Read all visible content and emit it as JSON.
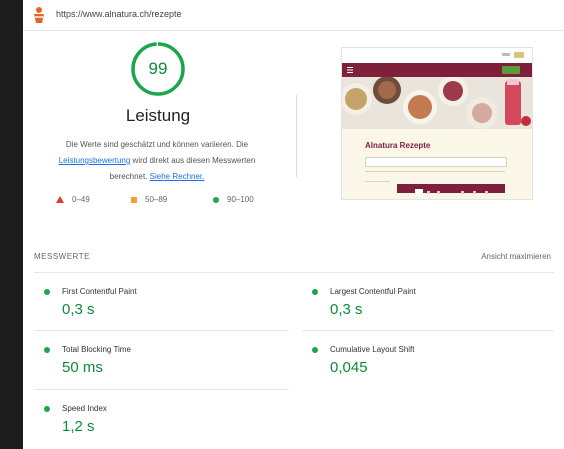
{
  "browser": {
    "url": "https://www.alnatura.ch/rezepte"
  },
  "score": {
    "value": 99,
    "fraction": 0.99,
    "title": "Leistung",
    "color": "#0c8a3b",
    "ring_color": "#1aa64b",
    "track_color": "#e3f5e8"
  },
  "description": {
    "line1": "Die Werte sind geschätzt und können variieren. Die",
    "link1": "Leistungsbewertung",
    "line2_rest": " wird direkt aus diesen Messwerten",
    "line3_prefix": "berechnet. ",
    "link2": "Siehe Rechner."
  },
  "legend": [
    {
      "icon": "triangle-icon",
      "range": "0–49",
      "color": "#e33a2c"
    },
    {
      "icon": "square-icon",
      "range": "50–89",
      "color": "#f0a030"
    },
    {
      "icon": "circle-icon",
      "range": "90–100",
      "color": "#1aa64b"
    }
  ],
  "thumbnail": {
    "title": "Alnatura Rezepte",
    "brand_color": "#7e1f3b"
  },
  "metrics_section": {
    "title": "MESSWERTE",
    "action": "Ansicht maximieren"
  },
  "metrics": [
    {
      "label": "First Contentful Paint",
      "value": "0,3 s"
    },
    {
      "label": "Largest Contentful Paint",
      "value": "0,3 s"
    },
    {
      "label": "Total Blocking Time",
      "value": "50 ms"
    },
    {
      "label": "Cumulative Layout Shift",
      "value": "0,045"
    },
    {
      "label": "Speed Index",
      "value": "1,2 s"
    }
  ]
}
